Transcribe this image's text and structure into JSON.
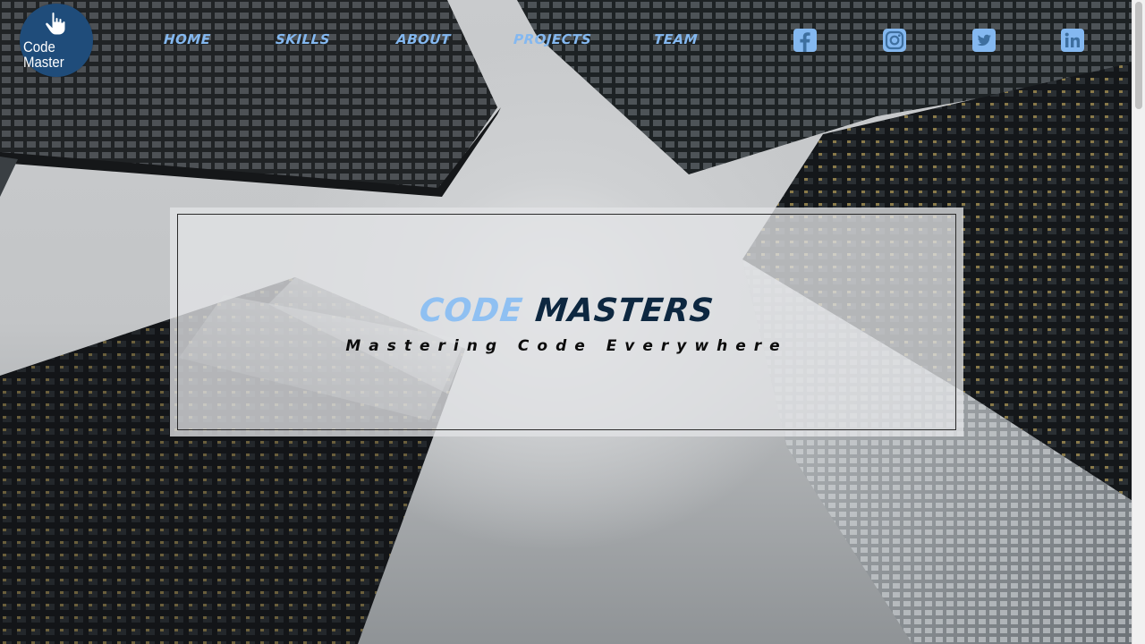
{
  "logo": {
    "line1": "Code",
    "line2": "Master",
    "icon": "hand-pointer-icon"
  },
  "nav": {
    "items": [
      {
        "label": "HOME"
      },
      {
        "label": "SKILLS"
      },
      {
        "label": "ABOUT"
      },
      {
        "label": "PROJECTS"
      },
      {
        "label": "TEAM"
      }
    ]
  },
  "social": [
    "facebook-icon",
    "instagram-icon",
    "twitter-icon",
    "linkedin-icon"
  ],
  "hero": {
    "title_part1": "CODE",
    "title_part2": "MASTERS",
    "subtitle": "Mastering Code Everywhere"
  },
  "colors": {
    "accent": "#84b8f0",
    "title_dark": "#0d2740",
    "logo_bg": "#1f4c7a"
  }
}
